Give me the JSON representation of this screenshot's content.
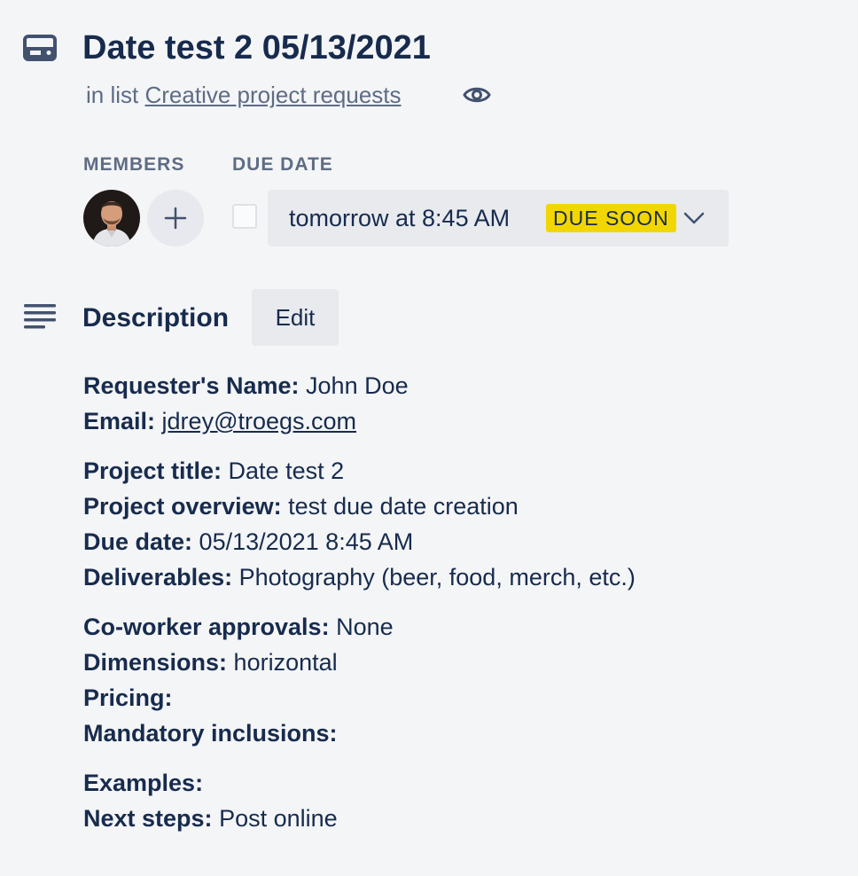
{
  "card": {
    "title": "Date test 2 05/13/2021",
    "list_prefix": "in list",
    "list_name": "Creative project requests"
  },
  "members_label": "MEMBERS",
  "due_date": {
    "label": "DUE DATE",
    "value": "tomorrow at 8:45 AM",
    "badge": "DUE SOON",
    "badge_color": "#f2d600"
  },
  "description": {
    "title": "Description",
    "edit_label": "Edit",
    "paragraphs": [
      [
        {
          "label": "Requester's Name:",
          "value": "John Doe"
        },
        {
          "label": "Email:",
          "value": "jdrey@troegs.com"
        }
      ],
      [
        {
          "label": "Project title:",
          "value": "Date test 2"
        },
        {
          "label": "Project overview:",
          "value": "test due date creation"
        },
        {
          "label": "Due date:",
          "value": "05/13/2021 8:45 AM"
        },
        {
          "label": "Deliverables:",
          "value": "Photography (beer, food, merch, etc.)"
        }
      ],
      [
        {
          "label": "Co-worker approvals:",
          "value": "None"
        },
        {
          "label": "Dimensions:",
          "value": "horizontal"
        },
        {
          "label": "Pricing:",
          "value": ""
        },
        {
          "label": "Mandatory inclusions:",
          "value": ""
        }
      ],
      [
        {
          "label": "Examples:",
          "value": ""
        },
        {
          "label": "Next steps:",
          "value": "Post online"
        }
      ]
    ]
  },
  "icons": {
    "card": "card-icon",
    "watch": "eye-icon",
    "add_member": "plus-icon",
    "due_dropdown": "chevron-down-icon",
    "description": "description-lines-icon"
  },
  "colors": {
    "text": "#172b4d",
    "muted": "#5e6c84",
    "background": "#f4f5f7",
    "button": "#e8eaee"
  }
}
